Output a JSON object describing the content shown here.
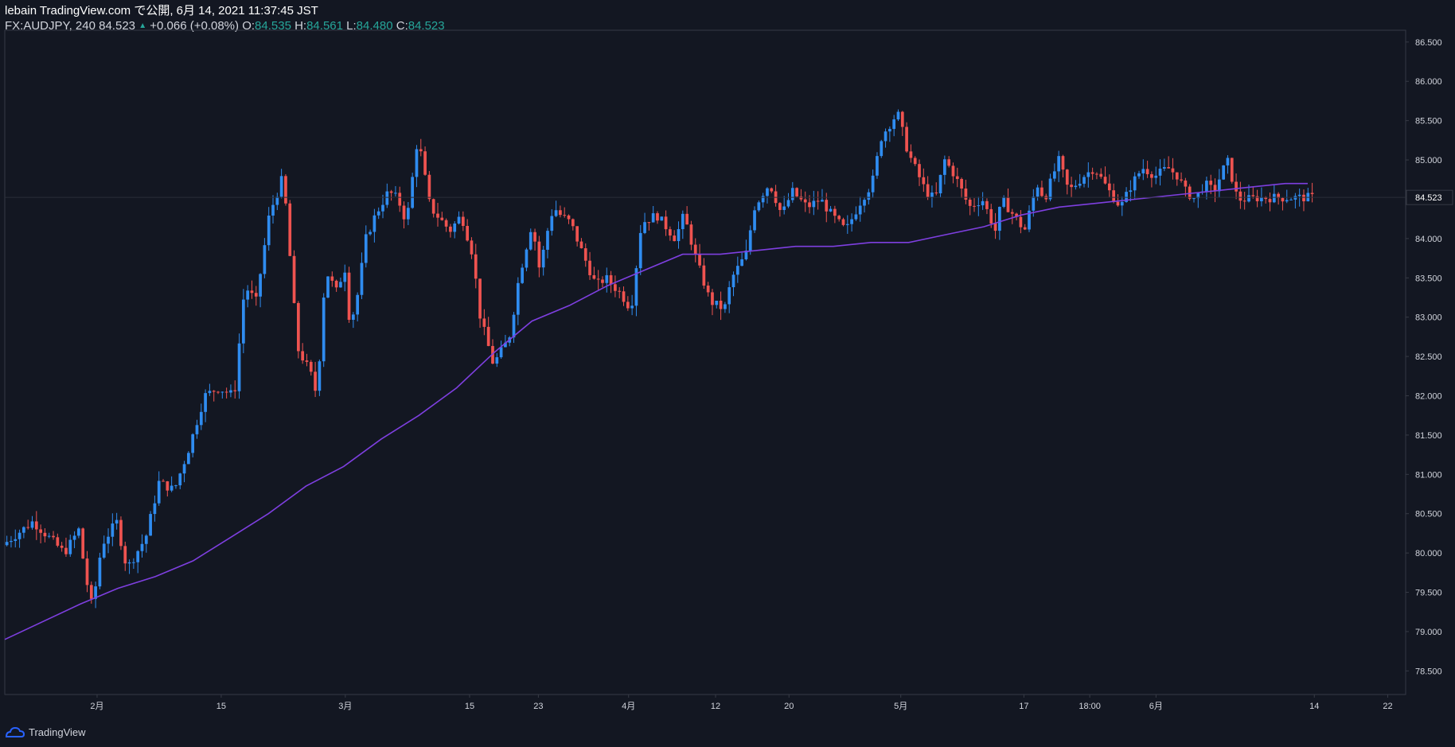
{
  "header": {
    "line1": "lebain TradingView.com で公開, 6月 14, 2021 11:37:45 JST",
    "symbol": "FX:AUDJPY, 240",
    "last": "84.523",
    "change": "+0.066 (+0.08%)",
    "o_label": "O:",
    "o_value": "84.535",
    "h_label": "H:",
    "h_value": "84.561",
    "l_label": "L:",
    "l_value": "84.480",
    "c_label": "C:",
    "c_value": "84.523"
  },
  "footer": {
    "brand": "TradingView"
  },
  "colors": {
    "background": "#131722",
    "up": "#2f8cf0",
    "down": "#ef5350",
    "ma": "#7e3fe0",
    "grid": "#363a45",
    "text": "#d1d4dc"
  },
  "chart_data": {
    "type": "candlestick",
    "symbol": "FX:AUDJPY",
    "interval": "240",
    "ylim": [
      78.2,
      86.65
    ],
    "y_ticks": [
      "78.500",
      "79.000",
      "79.500",
      "80.000",
      "80.500",
      "81.000",
      "81.500",
      "82.000",
      "82.500",
      "83.000",
      "83.500",
      "84.000",
      "84.500",
      "85.000",
      "85.500",
      "86.000",
      "86.500"
    ],
    "x_ticks": [
      {
        "label": "2月",
        "t": 0.0659
      },
      {
        "label": "15",
        "t": 0.1545
      },
      {
        "label": "3月",
        "t": 0.2431
      },
      {
        "label": "15",
        "t": 0.3318
      },
      {
        "label": "23",
        "t": 0.3809
      },
      {
        "label": "4月",
        "t": 0.4453
      },
      {
        "label": "12",
        "t": 0.5074
      },
      {
        "label": "20",
        "t": 0.5598
      },
      {
        "label": "5月",
        "t": 0.6396
      },
      {
        "label": "17",
        "t": 0.7275
      },
      {
        "label": "18:00",
        "t": 0.7745
      },
      {
        "label": "6月",
        "t": 0.8218
      },
      {
        "label": "14",
        "t": 0.9348
      },
      {
        "label": "22",
        "t": 0.9872
      }
    ],
    "price_series": {
      "t": [
        0,
        0.0215,
        0.033,
        0.044,
        0.0545,
        0.0591,
        0.0641,
        0.0706,
        0.0813,
        0.0887,
        0.1022,
        0.1116,
        0.1224,
        0.1324,
        0.1442,
        0.1539,
        0.1653,
        0.1728,
        0.1809,
        0.1903,
        0.2003,
        0.2105,
        0.2196,
        0.2243,
        0.2304,
        0.2391,
        0.2438,
        0.2479,
        0.2526,
        0.2593,
        0.2661,
        0.2755,
        0.2822,
        0.2883,
        0.2964,
        0.3051,
        0.3193,
        0.3274,
        0.3355,
        0.3409,
        0.3503,
        0.3604,
        0.3624,
        0.3685,
        0.3779,
        0.3833,
        0.3901,
        0.3934,
        0.3981,
        0.4055,
        0.4142,
        0.4237,
        0.4304,
        0.4412,
        0.4486,
        0.456,
        0.4668,
        0.4802,
        0.4863,
        0.4957,
        0.5051,
        0.5152,
        0.5206,
        0.5306,
        0.5367,
        0.5434,
        0.5475,
        0.5562,
        0.5636,
        0.5743,
        0.5837,
        0.5918,
        0.6019,
        0.6132,
        0.6206,
        0.6274,
        0.6388,
        0.6462,
        0.6589,
        0.6657,
        0.6724,
        0.6798,
        0.6899,
        0.6993,
        0.7087,
        0.7134,
        0.7215,
        0.7295,
        0.7383,
        0.7437,
        0.7537,
        0.7611,
        0.7719,
        0.7793,
        0.79,
        0.7981,
        0.8062,
        0.8136,
        0.823,
        0.8317,
        0.8385,
        0.8445,
        0.8512,
        0.858,
        0.8647,
        0.8741,
        0.8815,
        0.8889,
        0.897,
        0.9058,
        0.9132,
        0.9219,
        0.9267,
        0.9314
      ],
      "values": [
        80.1,
        80.4,
        80.2,
        80.0,
        80.3,
        79.7,
        79.3,
        80.1,
        80.4,
        79.8,
        80.2,
        80.9,
        80.8,
        81.3,
        82.0,
        82.1,
        82.0,
        83.4,
        83.2,
        84.3,
        84.8,
        82.6,
        82.3,
        82.0,
        83.6,
        83.3,
        83.7,
        82.9,
        83.2,
        84.0,
        84.3,
        84.6,
        84.5,
        84.2,
        85.3,
        84.4,
        84.1,
        84.3,
        83.8,
        83.0,
        82.4,
        82.7,
        82.8,
        83.5,
        84.2,
        83.6,
        84.2,
        84.4,
        84.3,
        84.2,
        83.8,
        83.4,
        83.5,
        83.3,
        83.1,
        84.2,
        84.3,
        84.0,
        84.3,
        83.7,
        83.2,
        83.1,
        83.5,
        83.8,
        84.4,
        84.6,
        84.7,
        84.3,
        84.6,
        84.4,
        84.5,
        84.3,
        84.1,
        84.5,
        84.7,
        85.3,
        85.6,
        85.1,
        84.6,
        84.5,
        85.0,
        84.8,
        84.4,
        84.5,
        84.1,
        84.5,
        84.3,
        84.1,
        84.7,
        84.5,
        85.0,
        84.6,
        84.8,
        84.9,
        84.6,
        84.4,
        84.7,
        84.9,
        84.8,
        84.9,
        84.8,
        84.6,
        84.5,
        84.7,
        84.6,
        85.0,
        84.5,
        84.5,
        84.52,
        84.52,
        84.52,
        84.52,
        84.52,
        84.523
      ],
      "end_t": 0.9348
    },
    "moving_average": {
      "t": [
        0,
        0.0538,
        0.0806,
        0.1075,
        0.1344,
        0.1613,
        0.1882,
        0.215,
        0.2419,
        0.2688,
        0.2956,
        0.3225,
        0.3494,
        0.3763,
        0.4032,
        0.4301,
        0.457,
        0.4839,
        0.5107,
        0.5376,
        0.5645,
        0.5914,
        0.6183,
        0.6452,
        0.672,
        0.6989,
        0.7258,
        0.7527,
        0.7796,
        0.8065,
        0.8333,
        0.8602,
        0.8871,
        0.914,
        0.9301
      ],
      "values": [
        78.9,
        79.35,
        79.55,
        79.7,
        79.9,
        80.2,
        80.5,
        80.85,
        81.1,
        81.45,
        81.75,
        82.1,
        82.55,
        82.95,
        83.15,
        83.4,
        83.6,
        83.8,
        83.8,
        83.85,
        83.9,
        83.9,
        83.95,
        83.95,
        84.05,
        84.15,
        84.3,
        84.4,
        84.45,
        84.5,
        84.55,
        84.6,
        84.65,
        84.7,
        84.7
      ]
    },
    "last_price": 84.523,
    "last_price_label": "84.523",
    "grid": false,
    "legend": "none"
  }
}
